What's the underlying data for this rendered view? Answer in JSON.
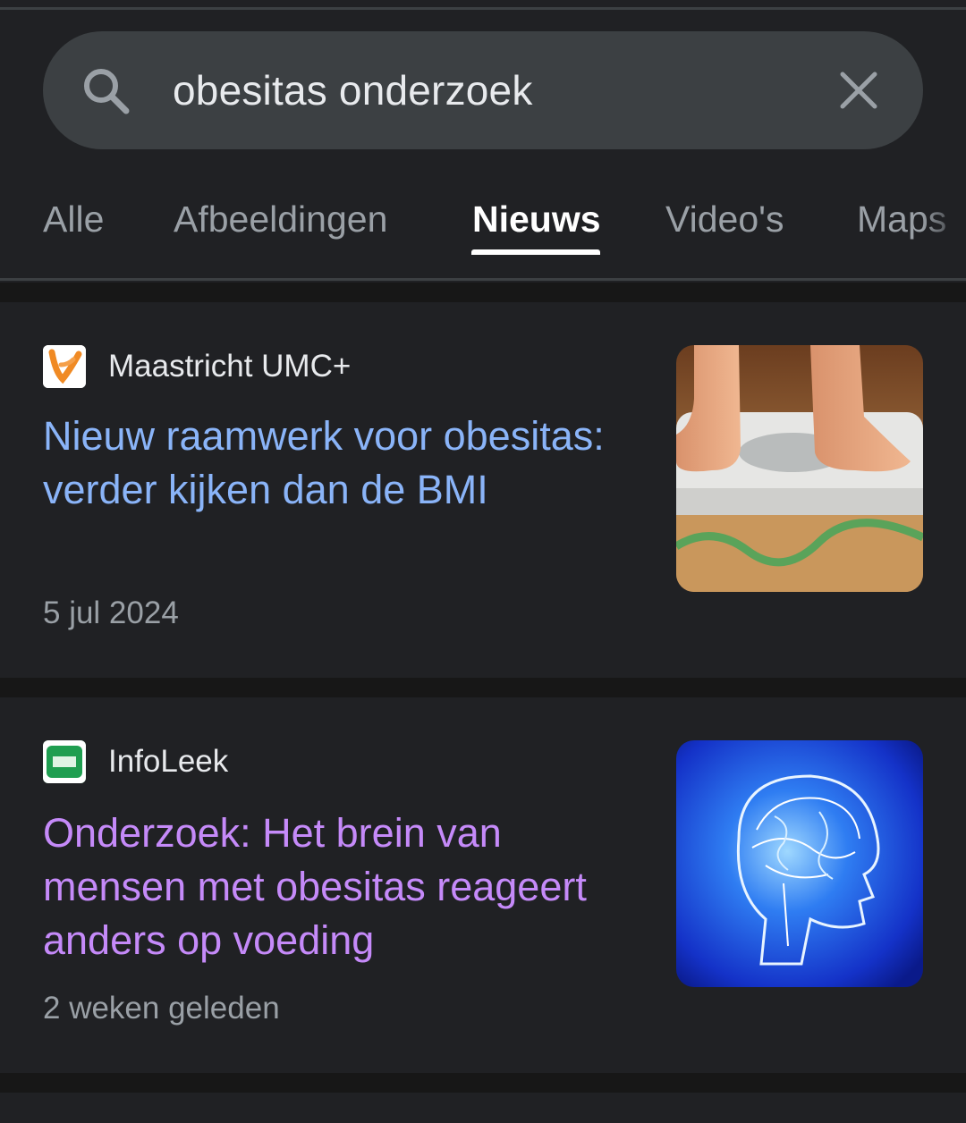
{
  "search": {
    "query": "obesitas onderzoek"
  },
  "tabs": [
    {
      "label": "Alle"
    },
    {
      "label": "Afbeeldingen"
    },
    {
      "label": "Nieuws"
    },
    {
      "label": "Video's"
    },
    {
      "label": "Maps"
    }
  ],
  "active_tab": "Nieuws",
  "results": [
    {
      "source": "Maastricht UMC+",
      "title": "Nieuw raamwerk voor obesitas: verder kijken dan de BMI",
      "date": "5 jul 2024",
      "title_color": "#8ab4f8",
      "thumbnail": "scale-feet-image"
    },
    {
      "source": "InfoLeek",
      "title": "Onderzoek: Het brein van mensen met obesitas reageert anders op voeding",
      "date": "2 weken geleden",
      "title_color": "#c58af9",
      "thumbnail": "brain-image"
    }
  ],
  "colors": {
    "background": "#202124",
    "searchbar": "#3c4043",
    "link_unvisited": "#8ab4f8",
    "link_visited": "#c58af9"
  }
}
